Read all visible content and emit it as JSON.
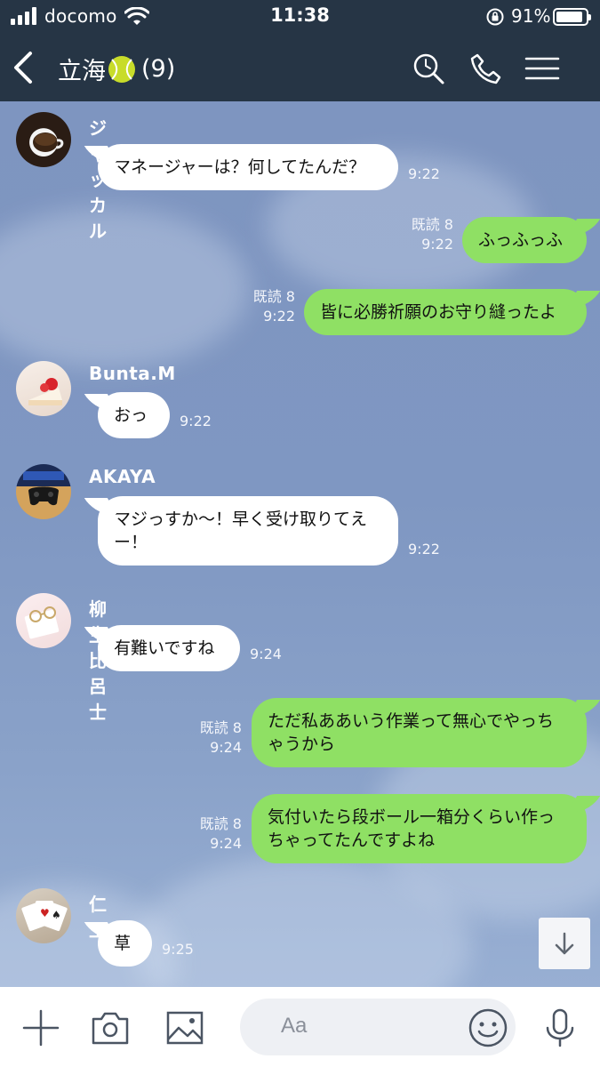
{
  "status_bar": {
    "carrier": "docomo",
    "time": "11:38",
    "battery_percent": "91%",
    "battery_level": 0.91,
    "icons": [
      "signal-icon",
      "wifi-icon",
      "rotation-lock-icon",
      "battery-icon"
    ]
  },
  "header": {
    "title": "立海",
    "member_count": "(9)",
    "title_emoji": "tennis-ball-icon",
    "icons": [
      "back-chevron-icon",
      "search-icon",
      "phone-icon",
      "menu-icon"
    ],
    "bar_color": "#263545"
  },
  "messages": [
    {
      "side": "in",
      "sender": "ジャッカル",
      "text": "マネージャーは？何してたんだ？",
      "time": "9:22",
      "avatar": "coffee-cup-avatar"
    },
    {
      "side": "out",
      "read": "既読 8",
      "text": "ふっふっふ",
      "time": "9:22"
    },
    {
      "side": "out",
      "read": "既読 8",
      "text": "皆に必勝祈願のお守り縫ったよ",
      "time": "9:22"
    },
    {
      "side": "in",
      "sender": "Bunta.M",
      "text": "おっ",
      "time": "9:22",
      "avatar": "cake-avatar"
    },
    {
      "side": "in",
      "sender": "AKAYA",
      "text": "マジっすか〜！早く受け取りてえ\nー！",
      "time": "9:22",
      "avatar": "game-controller-avatar"
    },
    {
      "side": "in",
      "sender": "柳生比呂士",
      "text": "有難いですね",
      "time": "9:24",
      "avatar": "glasses-avatar"
    },
    {
      "side": "out",
      "read": "既読 8",
      "text": "ただ私ああいう作業って無心でやっち\nゃうから",
      "time": "9:24"
    },
    {
      "side": "out",
      "read": "既読 8",
      "text": "気付いたら段ボール一箱分くらい作っ\nちゃってたんですよね",
      "time": "9:24"
    },
    {
      "side": "in",
      "sender": "仁王",
      "text": "草",
      "time": "9:25",
      "avatar": "playing-cards-avatar"
    }
  ],
  "input_bar": {
    "placeholder": "Aa",
    "icons": [
      "plus-icon",
      "camera-icon",
      "image-icon",
      "emoji-icon",
      "microphone-icon"
    ]
  },
  "colors": {
    "chat_background": "#7f97c2",
    "incoming_bubble": "#ffffff",
    "outgoing_bubble": "#8fe064"
  }
}
